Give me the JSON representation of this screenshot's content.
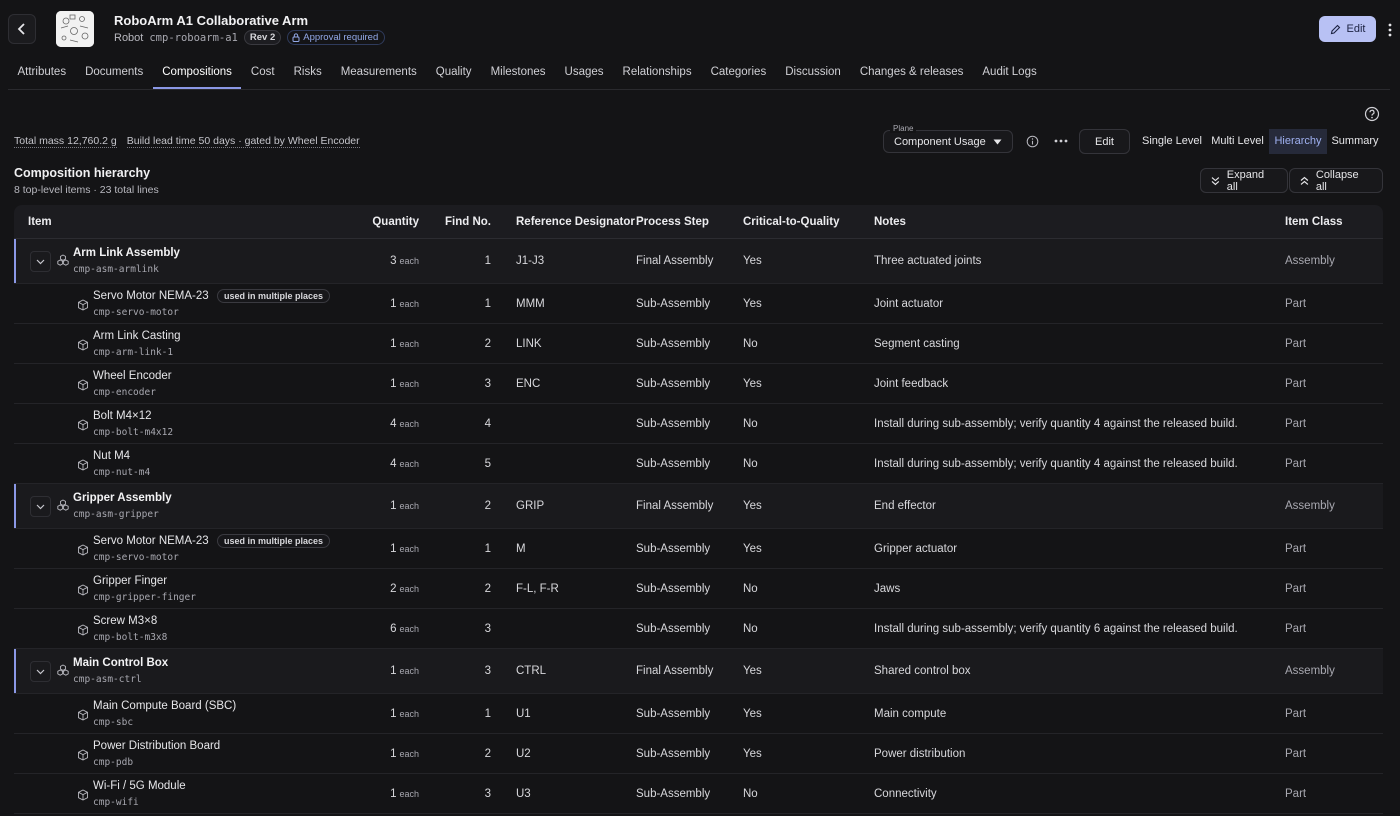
{
  "header": {
    "title": "RoboArm A1 Collaborative Arm",
    "type": "Robot",
    "code": "cmp-roboarm-a1",
    "revision": "Rev 2",
    "approval": "Approval required",
    "edit_label": "Edit"
  },
  "tabs": [
    {
      "label": "Attributes"
    },
    {
      "label": "Documents"
    },
    {
      "label": "Compositions",
      "active": true
    },
    {
      "label": "Cost"
    },
    {
      "label": "Risks"
    },
    {
      "label": "Measurements"
    },
    {
      "label": "Quality"
    },
    {
      "label": "Milestones"
    },
    {
      "label": "Usages"
    },
    {
      "label": "Relationships"
    },
    {
      "label": "Categories"
    },
    {
      "label": "Discussion"
    },
    {
      "label": "Changes & releases"
    },
    {
      "label": "Audit Logs"
    }
  ],
  "summary": {
    "total_mass": "Total mass 12,760.2 g",
    "lead_time": "Build lead time 50 days · gated by Wheel Encoder"
  },
  "toolbar": {
    "plane_label": "Plane",
    "plane_value": "Component Usage",
    "edit_label": "Edit",
    "views": [
      "Single Level",
      "Multi Level",
      "Hierarchy",
      "Summary"
    ],
    "active_view": "Hierarchy"
  },
  "composition": {
    "title": "Composition hierarchy",
    "subtitle": "8 top-level items · 23 total lines",
    "expand_all": "Expand all",
    "collapse_all": "Collapse all"
  },
  "table": {
    "columns": [
      "Item",
      "Quantity",
      "Find No.",
      "Reference Designator",
      "Process Step",
      "Critical-to-Quality",
      "Notes",
      "Item Class"
    ],
    "unit": "each",
    "multi_badge": "used in multiple places",
    "rows": [
      {
        "level": 0,
        "name": "Arm Link Assembly",
        "code": "cmp-asm-armlink",
        "qty": "3",
        "find": "1",
        "ref": "J1-J3",
        "step": "Final Assembly",
        "ctq": "Yes",
        "notes": "Three actuated joints",
        "class": "Assembly"
      },
      {
        "level": 1,
        "name": "Servo Motor NEMA-23",
        "code": "cmp-servo-motor",
        "multi": true,
        "qty": "1",
        "find": "1",
        "ref": "MMM",
        "step": "Sub-Assembly",
        "ctq": "Yes",
        "notes": "Joint actuator",
        "class": "Part"
      },
      {
        "level": 1,
        "name": "Arm Link Casting",
        "code": "cmp-arm-link-1",
        "qty": "1",
        "find": "2",
        "ref": "LINK",
        "step": "Sub-Assembly",
        "ctq": "No",
        "notes": "Segment casting",
        "class": "Part"
      },
      {
        "level": 1,
        "name": "Wheel Encoder",
        "code": "cmp-encoder",
        "qty": "1",
        "find": "3",
        "ref": "ENC",
        "step": "Sub-Assembly",
        "ctq": "Yes",
        "notes": "Joint feedback",
        "class": "Part"
      },
      {
        "level": 1,
        "name": "Bolt M4×12",
        "code": "cmp-bolt-m4x12",
        "qty": "4",
        "find": "4",
        "ref": "",
        "step": "Sub-Assembly",
        "ctq": "No",
        "notes": "Install during sub-assembly; verify quantity 4 against the released build.",
        "class": "Part"
      },
      {
        "level": 1,
        "name": "Nut M4",
        "code": "cmp-nut-m4",
        "qty": "4",
        "find": "5",
        "ref": "",
        "step": "Sub-Assembly",
        "ctq": "No",
        "notes": "Install during sub-assembly; verify quantity 4 against the released build.",
        "class": "Part"
      },
      {
        "level": 0,
        "name": "Gripper Assembly",
        "code": "cmp-asm-gripper",
        "qty": "1",
        "find": "2",
        "ref": "GRIP",
        "step": "Final Assembly",
        "ctq": "Yes",
        "notes": "End effector",
        "class": "Assembly"
      },
      {
        "level": 1,
        "name": "Servo Motor NEMA-23",
        "code": "cmp-servo-motor",
        "multi": true,
        "qty": "1",
        "find": "1",
        "ref": "M",
        "step": "Sub-Assembly",
        "ctq": "Yes",
        "notes": "Gripper actuator",
        "class": "Part"
      },
      {
        "level": 1,
        "name": "Gripper Finger",
        "code": "cmp-gripper-finger",
        "qty": "2",
        "find": "2",
        "ref": "F-L, F-R",
        "step": "Sub-Assembly",
        "ctq": "No",
        "notes": "Jaws",
        "class": "Part"
      },
      {
        "level": 1,
        "name": "Screw M3×8",
        "code": "cmp-bolt-m3x8",
        "qty": "6",
        "find": "3",
        "ref": "",
        "step": "Sub-Assembly",
        "ctq": "No",
        "notes": "Install during sub-assembly; verify quantity 6 against the released build.",
        "class": "Part"
      },
      {
        "level": 0,
        "name": "Main Control Box",
        "code": "cmp-asm-ctrl",
        "qty": "1",
        "find": "3",
        "ref": "CTRL",
        "step": "Final Assembly",
        "ctq": "Yes",
        "notes": "Shared control box",
        "class": "Assembly"
      },
      {
        "level": 1,
        "name": "Main Compute Board (SBC)",
        "code": "cmp-sbc",
        "qty": "1",
        "find": "1",
        "ref": "U1",
        "step": "Sub-Assembly",
        "ctq": "Yes",
        "notes": "Main compute",
        "class": "Part"
      },
      {
        "level": 1,
        "name": "Power Distribution Board",
        "code": "cmp-pdb",
        "qty": "1",
        "find": "2",
        "ref": "U2",
        "step": "Sub-Assembly",
        "ctq": "Yes",
        "notes": "Power distribution",
        "class": "Part"
      },
      {
        "level": 1,
        "name": "Wi-Fi / 5G Module",
        "code": "cmp-wifi",
        "qty": "1",
        "find": "3",
        "ref": "U3",
        "step": "Sub-Assembly",
        "ctq": "No",
        "notes": "Connectivity",
        "class": "Part"
      }
    ]
  },
  "colors": {
    "accent": "#8b98e6",
    "edit_button": "#b8c1f4",
    "background": "#141416"
  },
  "icons": {
    "back": "chevron-left-icon",
    "approval": "lock-icon",
    "edit": "pencil-icon",
    "assembly": "assembly-icon",
    "part": "cube-icon"
  }
}
